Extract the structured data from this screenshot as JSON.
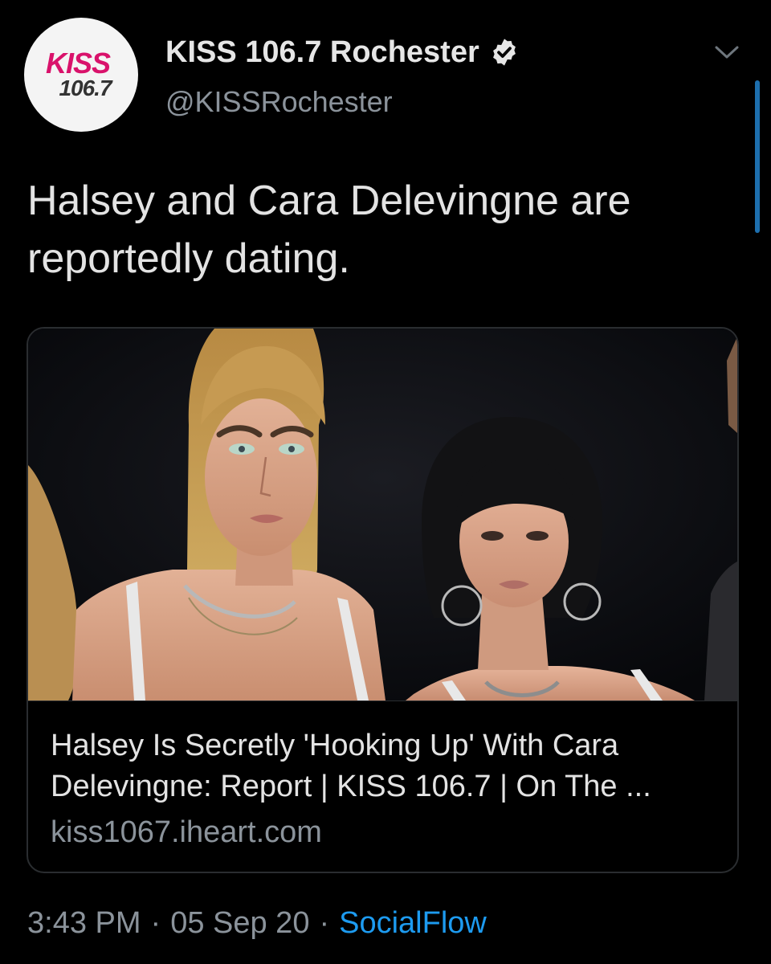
{
  "account": {
    "avatar_line1": "KISS",
    "avatar_line2": "106.7",
    "display_name": "KISS 106.7 Rochester",
    "handle": "@KISSRochester",
    "verified": true,
    "verified_icon": "verified-badge-icon"
  },
  "tweet": {
    "text": "Halsey and Cara Delevingne are reportedly dating."
  },
  "link_card": {
    "image_description_icon": "photo",
    "title": "Halsey Is Secretly 'Hooking Up' With Cara Delevingne: Report | KISS 106.7 | On The ...",
    "domain": "kiss1067.iheart.com"
  },
  "meta": {
    "time": "3:43 PM",
    "separator": "·",
    "date": "05 Sep 20",
    "source": "SocialFlow"
  },
  "colors": {
    "background": "#000000",
    "primary_text": "#e3e3e3",
    "secondary_text": "#8b939b",
    "accent": "#1d9bf0",
    "brand_pink": "#d9126b"
  }
}
